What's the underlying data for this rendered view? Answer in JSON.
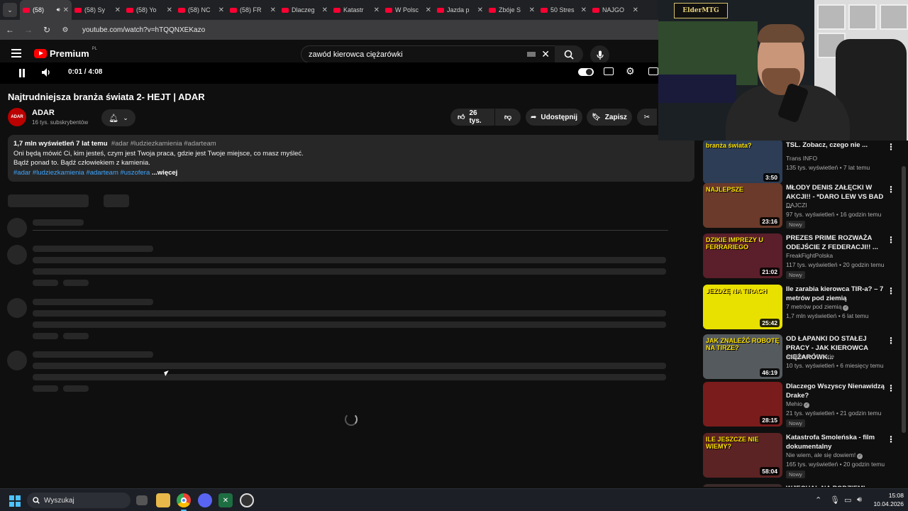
{
  "browser": {
    "tabs": [
      {
        "label": "(58)",
        "active": true
      },
      {
        "label": "(58) Sy"
      },
      {
        "label": "(58) Yo"
      },
      {
        "label": "(58) NC"
      },
      {
        "label": "(58) FR"
      },
      {
        "label": "Dlaczeg"
      },
      {
        "label": "Katastr"
      },
      {
        "label": "W Polsc"
      },
      {
        "label": "Jazda p"
      },
      {
        "label": "Zbóje S"
      },
      {
        "label": "50 Stres"
      },
      {
        "label": "NAJGO"
      }
    ],
    "url": "youtube.com/watch?v=hTQQNXEKazo"
  },
  "youtube": {
    "logo_text": "Premium",
    "logo_country": "PL",
    "search_value": "zawód kierowca ciężarówki",
    "player": {
      "time": "0:01 / 4:08",
      "progress_fraction": 0.004
    },
    "video": {
      "title": "Najtrudniejsza branża świata 2- HEJT | ADAR",
      "channel": "ADAR",
      "avatar_text": "ADAR",
      "subscribers": "16 tys. subskrybentów",
      "likes": "26 tys.",
      "share_label": "Udostępnij",
      "save_label": "Zapisz"
    },
    "description": {
      "stats": "1,7 mln wyświetleń  7 lat temu",
      "tags_inline": "#adar #ludziezkamienia #adarteam",
      "line1": "Oni będą mówić Ci, kim jesteś, czym jest Twoja praca, gdzie jest Twoje miejsce, co masz myśleć.",
      "line2": "Bądź ponad to. Bądź człowiekiem z kamienia.",
      "hashtags": "#adar #ludziezkamienia #adarteam #uszofera",
      "more": "...więcej"
    },
    "recommendations": [
      {
        "title": "TSL. Zobacz, czego nie ...",
        "channel": "Trans INFO",
        "meta": "135 tys. wyświetleń • 7 lat temu",
        "duration": "3:50",
        "thumb_text": "branża świata?",
        "thumb_color": "#2c3d55",
        "new": "",
        "verified": false
      },
      {
        "title": "MŁODY DENIS ZAŁĘCKI W AKCJI!! - *DARO LEW VS BAD ...",
        "channel": "DAJCZI",
        "meta": "97 tys. wyświetleń • 16 godzin temu",
        "duration": "23:16",
        "thumb_text": "NAJLEPSZE",
        "thumb_color": "#6b3a2a",
        "new": "Nowy",
        "verified": false
      },
      {
        "title": "PREZES PRIME ROZWAŻA ODEJŚCIE Z FEDERACJI!! ...",
        "channel": "FreakFightPolska",
        "meta": "117 tys. wyświetleń • 20 godzin temu",
        "duration": "21:02",
        "thumb_text": "DZIKIE IMPREZY U FERRARIEGO",
        "thumb_color": "#5a1f2a",
        "new": "Nowy",
        "verified": false
      },
      {
        "title": "Ile zarabia kierowca TIR-a? – 7 metrów pod ziemią",
        "channel": "7 metrów pod ziemią",
        "meta": "1,7 mln wyświetleń • 6 lat temu",
        "duration": "25:42",
        "thumb_text": "JEŻDŻĘ NA TIRACH",
        "thumb_color": "#e8e100",
        "new": "",
        "verified": true
      },
      {
        "title": "OD ŁAPANKI DO STAŁEJ PRACY - JAK KIEROWCA CIĘŻARÓWK...",
        "channel": "Asfaltowe Historie",
        "meta": "10 tys. wyświetleń • 6 miesięcy temu",
        "duration": "46:19",
        "thumb_text": "JAK ZNALEŹĆ ROBOTĘ NA TIRZE?",
        "thumb_color": "#555a5e",
        "new": "",
        "verified": false
      },
      {
        "title": "Dlaczego Wszyscy Nienawidzą Drake?",
        "channel": "Mehio",
        "meta": "21 tys. wyświetleń • 21 godzin temu",
        "duration": "28:15",
        "thumb_text": "",
        "thumb_color": "#7a1c1c",
        "new": "Nowy",
        "verified": true
      },
      {
        "title": "Katastrofa Smoleńska - film dokumentalny",
        "channel": "Nie wiem, ale się dowiem!",
        "meta": "165 tys. wyświetleń • 20 godzin temu",
        "duration": "58:04",
        "thumb_text": "ILE JESZCZE NIE WIEMY?",
        "thumb_color": "#5b2323",
        "new": "Nowy",
        "verified": true
      },
      {
        "title": "WJECHAŁ NA PODZIEMI...",
        "channel": "",
        "meta": "",
        "duration": "",
        "thumb_text": "",
        "thumb_color": "#3a2a2a",
        "new": "",
        "verified": false
      }
    ]
  },
  "webcam": {
    "logo_text": "ElderMTG"
  },
  "taskbar": {
    "search_placeholder": "Wyszukaj",
    "time": "15:08",
    "date": "10.04.2026"
  },
  "colors": {
    "accent_red": "#ff0000",
    "link_blue": "#3ea6ff",
    "bg": "#0f0f0f",
    "surface": "#272727"
  }
}
